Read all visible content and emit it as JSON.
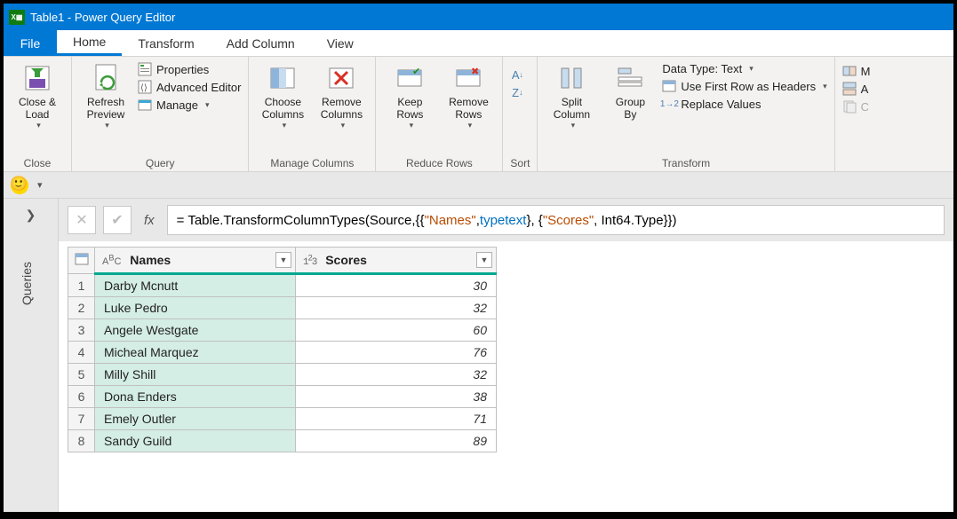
{
  "title": "Table1 - Power Query Editor",
  "tabs": {
    "file": "File",
    "home": "Home",
    "transform": "Transform",
    "add_column": "Add Column",
    "view": "View"
  },
  "ribbon": {
    "close": {
      "close_load": "Close &\nLoad",
      "group": "Close"
    },
    "query": {
      "refresh": "Refresh\nPreview",
      "properties": "Properties",
      "advanced": "Advanced Editor",
      "manage": "Manage",
      "group": "Query"
    },
    "columns": {
      "choose": "Choose\nColumns",
      "remove": "Remove\nColumns",
      "group": "Manage Columns"
    },
    "rows": {
      "keep": "Keep\nRows",
      "remove": "Remove\nRows",
      "group": "Reduce Rows"
    },
    "sort": {
      "group": "Sort"
    },
    "transform": {
      "split": "Split\nColumn",
      "groupby": "Group\nBy",
      "datatype": "Data Type: Text",
      "firstrow": "Use First Row as Headers",
      "replace": "Replace Values",
      "group": "Transform"
    },
    "trunc": {
      "m": "M",
      "a": "A",
      "c": "C"
    }
  },
  "formula": {
    "prefix": "= Table.TransformColumnTypes(Source,{{",
    "s1": "\"Names\"",
    "mid1": ", ",
    "kw1": "type",
    "mid1b": " ",
    "kw2": "text",
    "mid2": "}, {",
    "s2": "\"Scores\"",
    "mid3": ", Int64.Type}})"
  },
  "grid": {
    "columns": [
      {
        "type": "ABC",
        "name": "Names"
      },
      {
        "type": "123",
        "name": "Scores"
      }
    ],
    "rows": [
      {
        "n": "1",
        "name": "Darby Mcnutt",
        "score": "30"
      },
      {
        "n": "2",
        "name": "Luke Pedro",
        "score": "32"
      },
      {
        "n": "3",
        "name": "Angele Westgate",
        "score": "60"
      },
      {
        "n": "4",
        "name": "Micheal Marquez",
        "score": "76"
      },
      {
        "n": "5",
        "name": "Milly Shill",
        "score": "32"
      },
      {
        "n": "6",
        "name": "Dona Enders",
        "score": "38"
      },
      {
        "n": "7",
        "name": "Emely Outler",
        "score": "71"
      },
      {
        "n": "8",
        "name": "Sandy Guild",
        "score": "89"
      }
    ]
  },
  "queries_label": "Queries"
}
